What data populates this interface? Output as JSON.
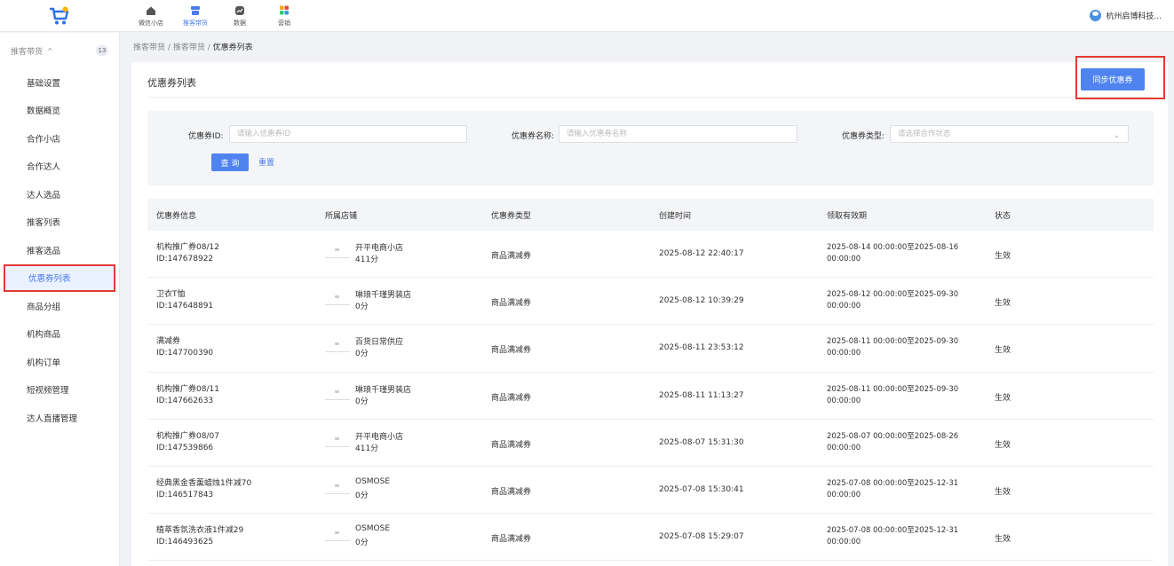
{
  "topnav": [
    {
      "label": "微信小店",
      "icon": "home-icon"
    },
    {
      "label": "推客带货",
      "icon": "store-icon",
      "active": true
    },
    {
      "label": "数据",
      "icon": "data-icon"
    },
    {
      "label": "营销",
      "icon": "marketing-icon"
    }
  ],
  "company": "杭州启博科技...",
  "sidebar": {
    "group_label": "推客带货",
    "group_badge": "13",
    "items": [
      {
        "label": "基础设置"
      },
      {
        "label": "数据概览"
      },
      {
        "label": "合作小店"
      },
      {
        "label": "合作达人"
      },
      {
        "label": "达人选品"
      },
      {
        "label": "推客列表"
      },
      {
        "label": "推客选品"
      },
      {
        "label": "优惠券列表",
        "active": true
      },
      {
        "label": "商品分组"
      },
      {
        "label": "机构商品"
      },
      {
        "label": "机构订单"
      },
      {
        "label": "短视频管理"
      },
      {
        "label": "达人直播管理"
      }
    ]
  },
  "breadcrumb": {
    "first": "推客带货",
    "sep": "/",
    "second": "推客带货",
    "current": "优惠券列表"
  },
  "page": {
    "title": "优惠券列表",
    "sync_label": "同步优惠券"
  },
  "filter": {
    "id_label": "优惠券ID:",
    "id_placeholder": "请输入优惠券ID",
    "name_label": "优惠券名称:",
    "name_placeholder": "请输入优惠券名称",
    "type_label": "优惠券类型:",
    "type_placeholder": "请选择合作状态",
    "query_label": "查 询",
    "reset_label": "重置"
  },
  "table": {
    "headers": [
      "优惠券信息",
      "所属店铺",
      "优惠券类型",
      "创建时间",
      "领取有效期",
      "状态"
    ],
    "rows": [
      {
        "name": "机构推广券08/12",
        "id": "ID:147678922",
        "shop": "开平电商小店",
        "score": "411分",
        "type": "商品满减券",
        "created": "2025-08-12 22:40:17",
        "valid1": "2025-08-14 00:00:00至2025-08-16",
        "valid2": "00:00:00",
        "status": "生效"
      },
      {
        "name": "卫衣T恤",
        "id": "ID:147648891",
        "shop": "琳琅千瑾男装店",
        "score": "0分",
        "type": "商品满减券",
        "created": "2025-08-12 10:39:29",
        "valid1": "2025-08-12 00:00:00至2025-09-30",
        "valid2": "00:00:00",
        "status": "生效"
      },
      {
        "name": "满减券",
        "id": "ID:147700390",
        "shop": "百货日常供应",
        "score": "0分",
        "type": "商品满减券",
        "created": "2025-08-11 23:53:12",
        "valid1": "2025-08-11 00:00:00至2025-09-30",
        "valid2": "00:00:00",
        "status": "生效"
      },
      {
        "name": "机构推广券08/11",
        "id": "ID:147662633",
        "shop": "琳琅千瑾男装店",
        "score": "0分",
        "type": "商品满减券",
        "created": "2025-08-11 11:13:27",
        "valid1": "2025-08-11 00:00:00至2025-09-30",
        "valid2": "00:00:00",
        "status": "生效"
      },
      {
        "name": "机构推广券08/07",
        "id": "ID:147539866",
        "shop": "开平电商小店",
        "score": "411分",
        "type": "商品满减券",
        "created": "2025-08-07 15:31:30",
        "valid1": "2025-08-07 00:00:00至2025-08-26",
        "valid2": "00:00:00",
        "status": "生效"
      },
      {
        "name": "经典黑金香薰蜡烛1件减70",
        "id": "ID:146517843",
        "shop": "OSMOSE",
        "score": "0分",
        "type": "商品满减券",
        "created": "2025-07-08 15:30:41",
        "valid1": "2025-07-08 00:00:00至2025-12-31",
        "valid2": "00:00:00",
        "status": "生效"
      },
      {
        "name": "植萃香氛洗衣液1件减29",
        "id": "ID:146493625",
        "shop": "OSMOSE",
        "score": "0分",
        "type": "商品满减券",
        "created": "2025-07-08 15:29:07",
        "valid1": "2025-07-08 00:00:00至2025-12-31",
        "valid2": "00:00:00",
        "status": "生效"
      }
    ]
  },
  "colors": {
    "accent": "#4f84f0",
    "highlight": "#e53935"
  }
}
